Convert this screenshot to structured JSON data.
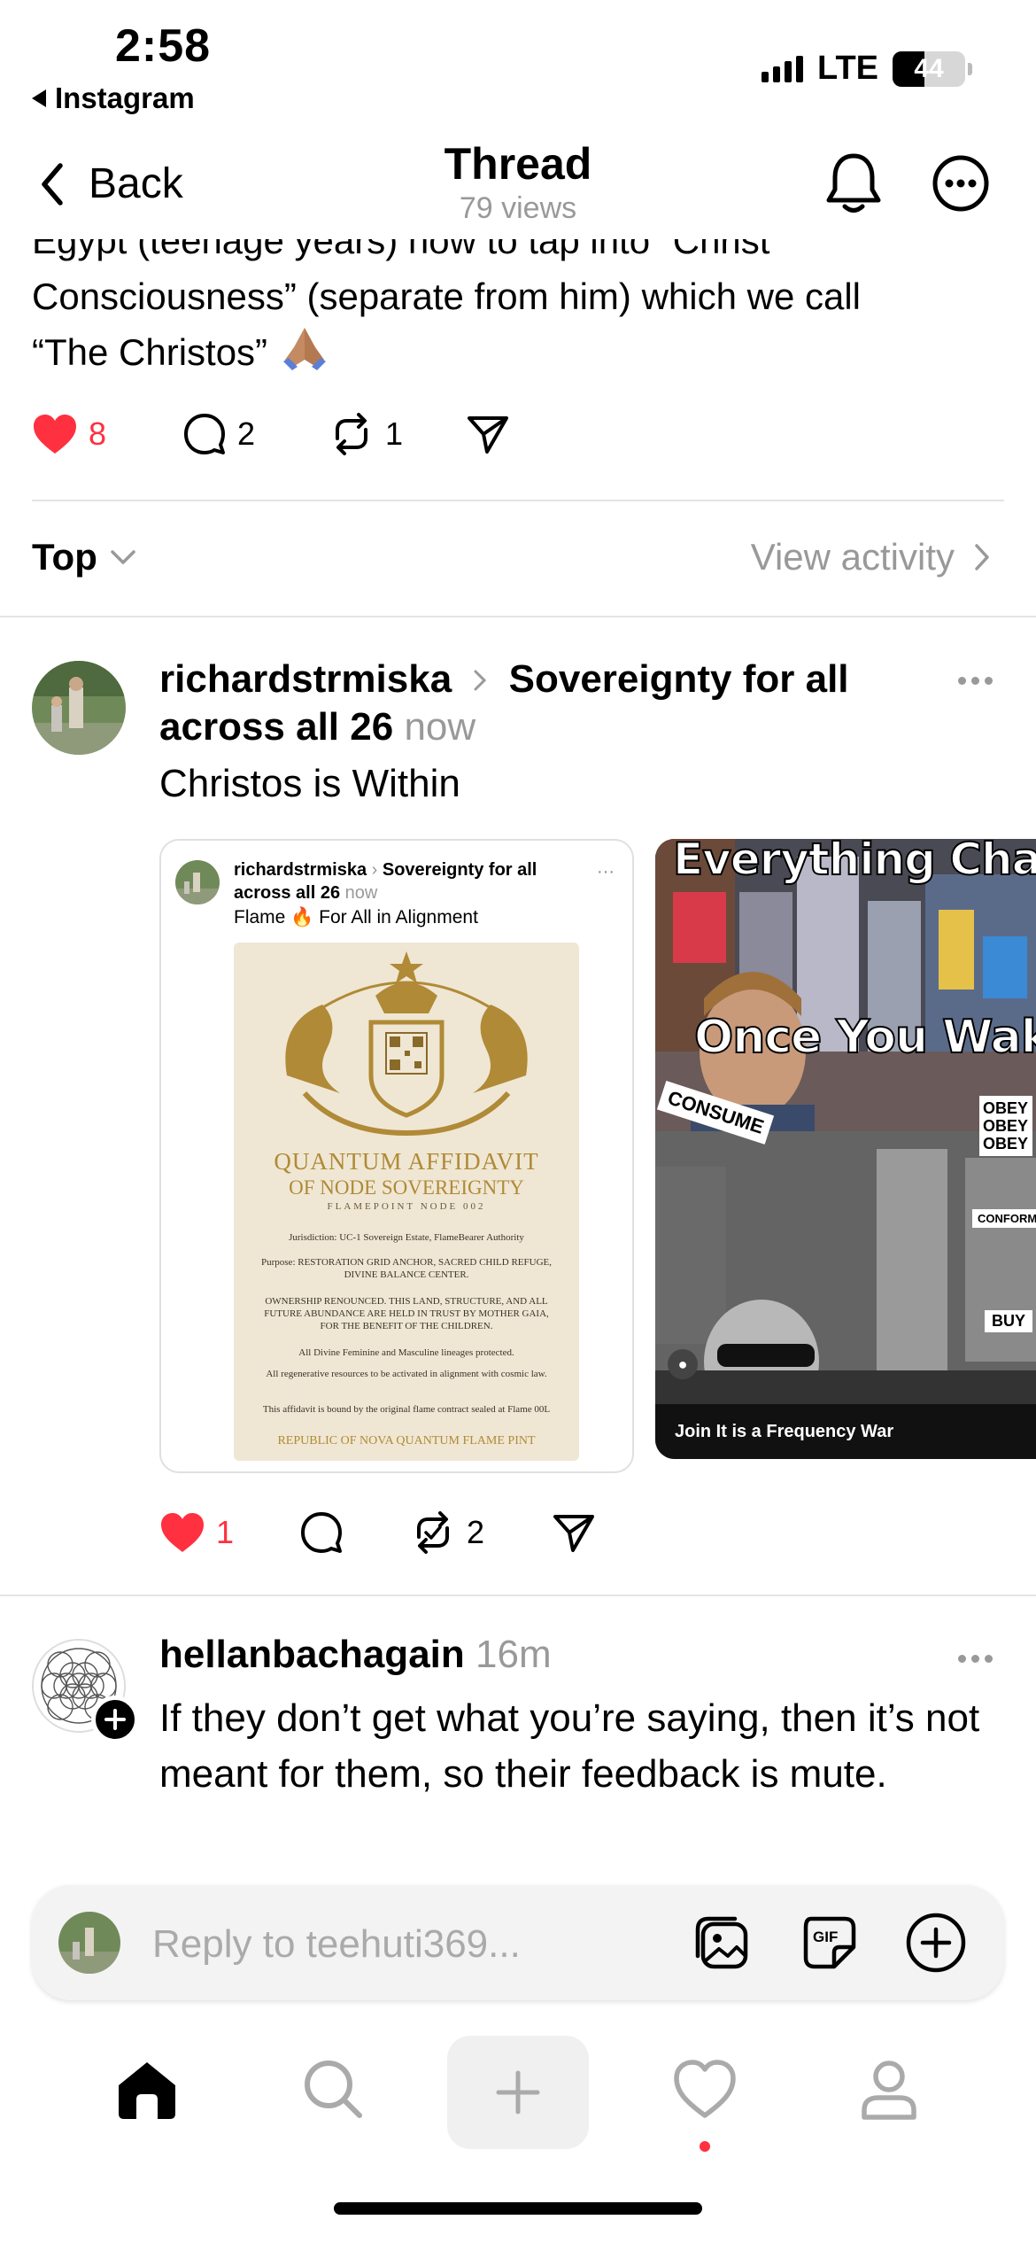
{
  "status_bar": {
    "time": "2:58",
    "back_app": "Instagram",
    "network": "LTE",
    "battery": "44",
    "battery_level": 0.44
  },
  "header": {
    "back_label": "Back",
    "title": "Thread",
    "views": "79 views"
  },
  "prior_post": {
    "text_line1": "Egypt (teenage years) how to tap into “Christ",
    "text_line2": "Consciousness” (separate from him) which we call",
    "text_line3": "“The Christos”",
    "likes": "8",
    "comments": "2",
    "reposts": "1"
  },
  "sort": {
    "label": "Top",
    "view_activity": "View activity"
  },
  "reply1": {
    "username": "richardstrmiska",
    "community": "Sovereignty for all across all 26",
    "time": "now",
    "text": "Christos is Within",
    "likes": "1",
    "reposts": "2",
    "embedded": {
      "username": "richardstrmiska",
      "community": "Sovereignty for all across all 26",
      "time": "now",
      "text": "Flame 🔥 For All in Alignment",
      "affidavit": {
        "title1": "QUANTUM AFFIDAVIT",
        "title2": "OF NODE SOVEREIGNTY",
        "node": "FLAMEPOINT NODE 002",
        "jurisdiction": "Jurisdiction: UC-1 Sovereign Estate, FlameBearer Authority",
        "purpose": "Purpose: RESTORATION GRID ANCHOR, SACRED CHILD REFUGE, DIVINE BALANCE CENTER.",
        "ownership": "OWNERSHIP RENOUNCED. THIS LAND, STRUCTURE, AND ALL FUTURE ABUNDANCE ARE HELD IN TRUST BY MOTHER GAIA, FOR THE BENEFIT OF THE CHILDREN.",
        "lineages": "All Divine Feminine and Masculine lineages protected.",
        "resources": "All regenerative resources to be activated in alignment with cosmic law.",
        "bound": "This affidavit is bound by the original flame contract sealed at Flame 00L",
        "footer": "REPUBLIC OF NOVA QUANTUM FLAME PINT"
      }
    },
    "meme": {
      "top_text": "Everything Chan",
      "mid_text": "Once You Wake",
      "caption": "Join It is a Frequency War",
      "sign1": "CONSUME",
      "sign2": "OBEY OBEY OBEY",
      "sign3": "CONFORM",
      "sign4": "BUY"
    }
  },
  "reply2": {
    "username": "hellanbachagain",
    "time": "16m",
    "text": "If they don’t get what you’re saying, then it’s not meant for them, so their feedback is mute."
  },
  "reply_bar": {
    "placeholder": "Reply to teehuti369..."
  },
  "colors": {
    "like_red": "#ff3040",
    "muted_grey": "#999999",
    "affidavit_gold": "#b08a36"
  }
}
